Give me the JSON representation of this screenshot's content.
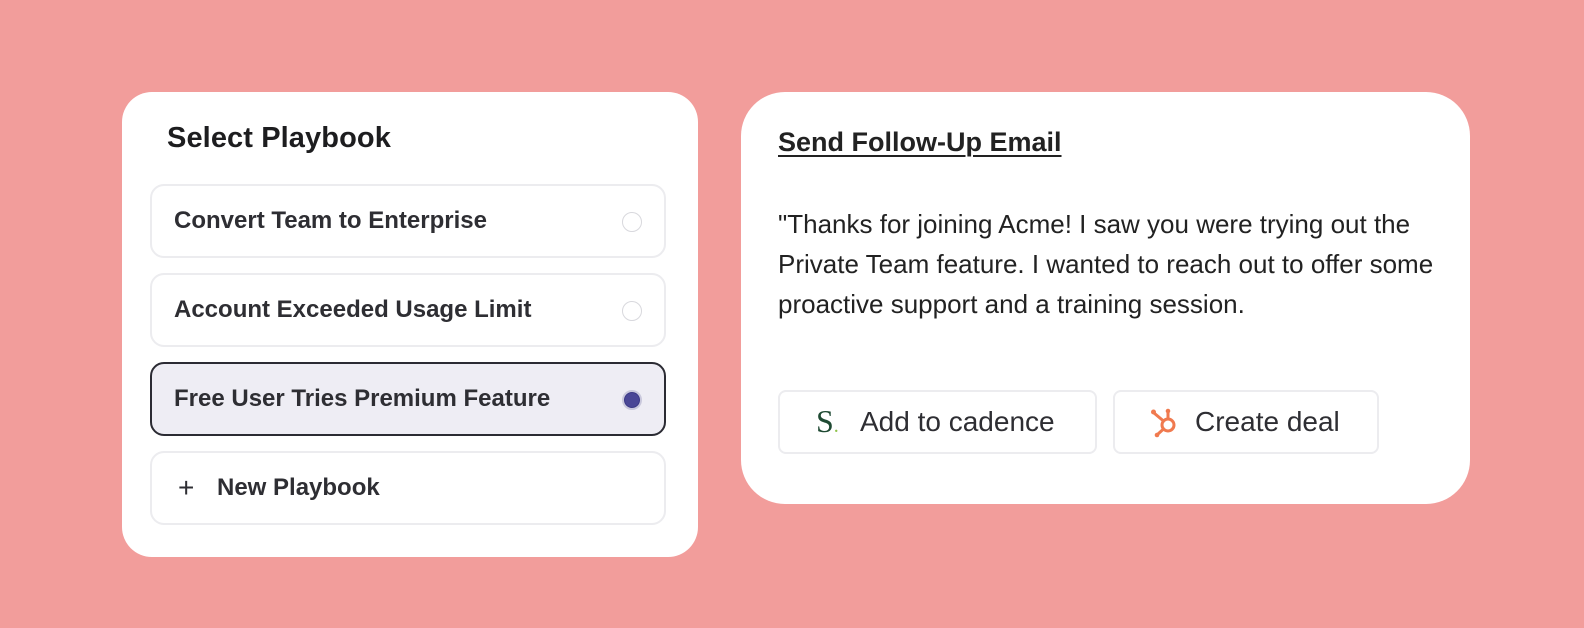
{
  "playbook_panel": {
    "title": "Select Playbook",
    "options": [
      {
        "label": "Convert Team to Enterprise",
        "selected": false
      },
      {
        "label": "Account Exceeded Usage Limit",
        "selected": false
      },
      {
        "label": "Free User Tries Premium Feature",
        "selected": true
      }
    ],
    "new_playbook": {
      "icon": "plus-icon",
      "label": "New Playbook"
    }
  },
  "email_panel": {
    "title": "Send Follow-Up Email",
    "body": "\"Thanks for joining Acme! I saw you were trying out the Private Team feature. I wanted to reach out to offer some proactive support and a training session.",
    "actions": [
      {
        "icon": "salesloft-icon",
        "label": "Add to cadence"
      },
      {
        "icon": "hubspot-icon",
        "label": "Create deal"
      }
    ]
  },
  "colors": {
    "background": "#f29d9b",
    "card": "#ffffff",
    "selected_fill": "#eeedf4",
    "radio_selected": "#4a4796",
    "hubspot_orange": "#f07a4f",
    "salesloft_green": "#1f4a33"
  }
}
